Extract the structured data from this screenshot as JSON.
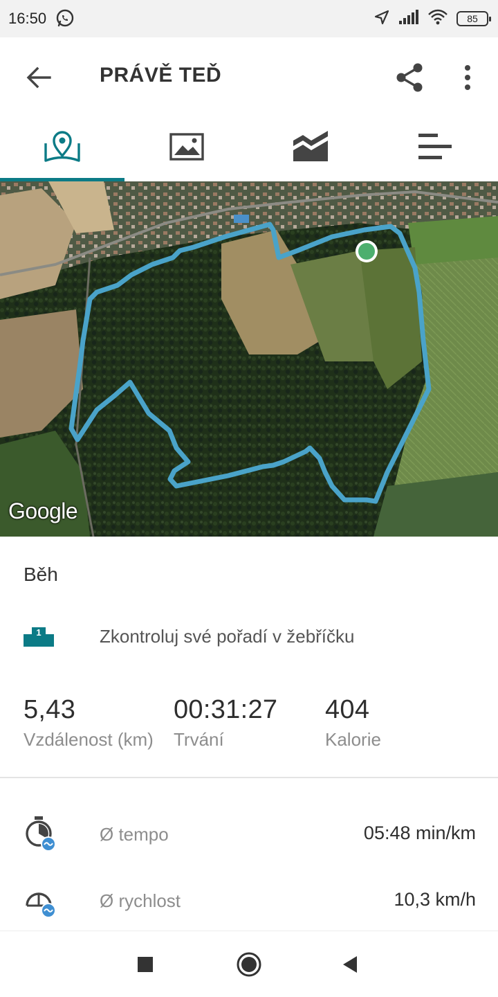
{
  "status_bar": {
    "time": "16:50",
    "battery": "85"
  },
  "toolbar": {
    "title": "PRÁVĚ TEĎ"
  },
  "tabs": [
    {
      "name": "map-tab",
      "icon": "map-pin-icon",
      "active": true
    },
    {
      "name": "photos-tab",
      "icon": "image-icon",
      "active": false
    },
    {
      "name": "charts-tab",
      "icon": "area-chart-icon",
      "active": false
    },
    {
      "name": "splits-tab",
      "icon": "bars-icon",
      "active": false
    }
  ],
  "map": {
    "attribution": "Google",
    "route_color": "#4aa3c9",
    "end_marker_color": "#4caf6e"
  },
  "activity": {
    "type": "Běh",
    "ranking_text": "Zkontroluj své pořadí v žebříčku",
    "ranking_badge": "1"
  },
  "stats": {
    "distance": {
      "value": "5,43",
      "label": "Vzdálenost (km)"
    },
    "duration": {
      "value": "00:31:27",
      "label": "Trvání"
    },
    "calories": {
      "value": "404",
      "label": "Kalorie"
    }
  },
  "metrics": [
    {
      "label": "Ø tempo",
      "value": "05:48 min/km",
      "icon": "stopwatch-icon"
    },
    {
      "label": "Ø rychlost",
      "value": "10,3 km/h",
      "icon": "speedometer-icon"
    }
  ],
  "colors": {
    "accent": "#0c7b86",
    "icon_grey": "#444444"
  }
}
